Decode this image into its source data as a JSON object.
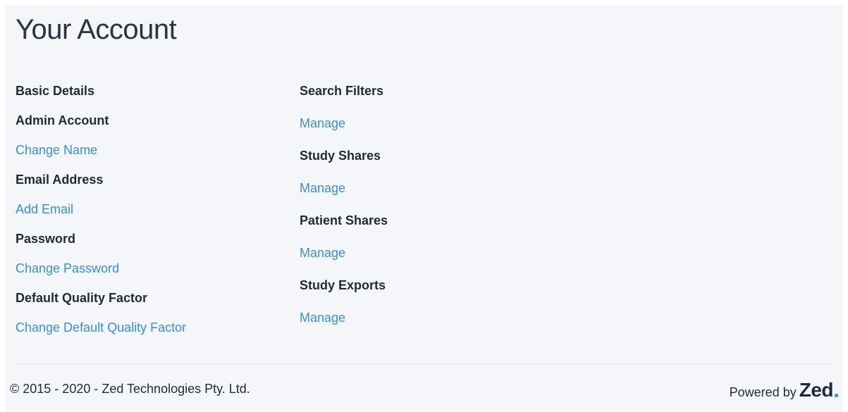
{
  "page": {
    "title": "Your Account"
  },
  "left": {
    "basic_details": "Basic Details",
    "admin_account": "Admin Account",
    "change_name": "Change Name",
    "email_address": "Email Address",
    "add_email": "Add Email",
    "password": "Password",
    "change_password": "Change Password",
    "default_quality_factor": "Default Quality Factor",
    "change_default_quality_factor": "Change Default Quality Factor"
  },
  "right": {
    "search_filters": "Search Filters",
    "search_filters_manage": "Manage",
    "study_shares": "Study Shares",
    "study_shares_manage": "Manage",
    "patient_shares": "Patient Shares",
    "patient_shares_manage": "Manage",
    "study_exports": "Study Exports",
    "study_exports_manage": "Manage"
  },
  "footer": {
    "copyright": "© 2015 - 2020 - Zed Technologies Pty. Ltd.",
    "powered_by": "Powered by",
    "logo_text": "Zed"
  },
  "colors": {
    "link": "#3a8fd3",
    "logo_accent": "#3aa0e6"
  }
}
